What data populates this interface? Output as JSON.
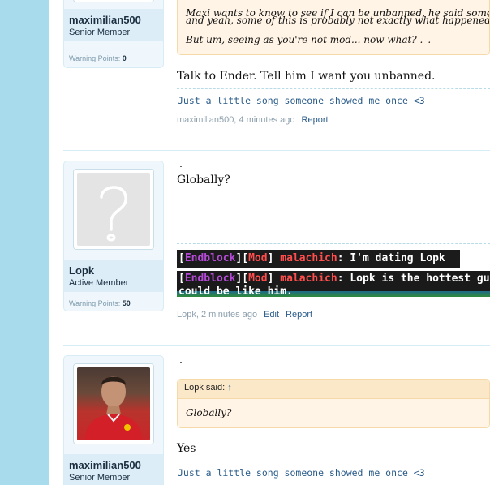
{
  "colors": {
    "page_bg": "#a8dcec",
    "link": "#2a5c8a",
    "username": "#1a2e3f",
    "quote_bg": "#fff4e5",
    "quote_border": "#f6d9a8"
  },
  "post1": {
    "username": "maximilian500",
    "usertitle": "Senior Member",
    "warning_label": "Warning Points:",
    "warning_value": "0",
    "quote_lines": [
      "Maxi wants to know to see if I can be unbanned, he said something lik",
      "and yeah, some of this is probably not exactly what happened cx.",
      "But um, seeing as you're not mod... now what? ._."
    ],
    "message": "Talk to Ender. Tell him I want you unbanned.",
    "signature": "Just a little song someone showed me once <3",
    "meta_author_time": "maximilian500, 4 minutes ago",
    "report_label": "Report"
  },
  "post2": {
    "username": "Lopk",
    "usertitle": "Active Member",
    "warning_label": "Warning Points:",
    "warning_value": "50",
    "avatar_icon": "question-mark-icon",
    "message": "Globally?",
    "chat_line1": {
      "bracket_open": "[",
      "server": "Endblock",
      "bracket_mid": "][",
      "rank": "Mod",
      "bracket_close": "] ",
      "player": "malachich",
      "colon": ": ",
      "text": "I'm dating Lopk"
    },
    "chat_line2": {
      "bracket_open": "[",
      "server": "Endblock",
      "bracket_mid": "][",
      "rank": "Mod",
      "bracket_close": "] ",
      "player": "malachich",
      "colon": ": ",
      "text": "Lopk is the hottest gu",
      "text2": "could be like him."
    },
    "meta_author_time": "Lopk, 2 minutes ago",
    "edit_label": "Edit",
    "report_label": "Report"
  },
  "post3": {
    "username": "maximilian500",
    "usertitle": "Senior Member",
    "quote_author": "Lopk said:",
    "quote_arrow": "↑",
    "quote_text": "Globally?",
    "message": "Yes",
    "signature": "Just a little song someone showed me once <3"
  }
}
